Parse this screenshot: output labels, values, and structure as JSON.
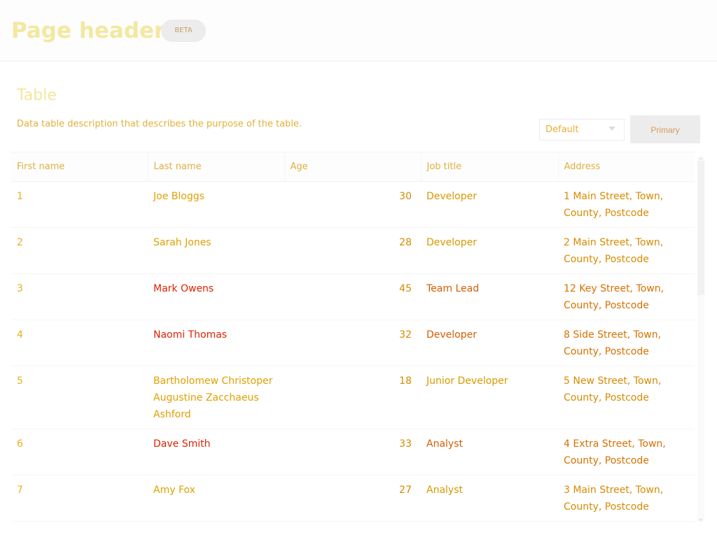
{
  "header": {
    "title": "Page header",
    "badge": "BETA"
  },
  "section": {
    "title": "Table",
    "description": "Data table description that describes the purpose of the table."
  },
  "toolbar": {
    "select_value": "Default",
    "primary_label": "Primary"
  },
  "table": {
    "columns": [
      "First name",
      "Last name",
      "Age",
      "Job title",
      "Address"
    ],
    "rows": [
      {
        "id": "1",
        "name": "Joe Bloggs",
        "age": "30",
        "job": "Developer",
        "address": "1 Main Street, Town, County, Postcode"
      },
      {
        "id": "2",
        "name": "Sarah Jones",
        "age": "28",
        "job": "Developer",
        "address": "2 Main Street, Town, County, Postcode"
      },
      {
        "id": "3",
        "name": "Mark Owens",
        "age": "45",
        "job": "Team Lead",
        "address": "12 Key Street, Town, County, Postcode"
      },
      {
        "id": "4",
        "name": "Naomi Thomas",
        "age": "32",
        "job": "Developer",
        "address": "8 Side Street, Town, County, Postcode"
      },
      {
        "id": "5",
        "name": "Bartholomew Christoper Augustine Zacchaeus Ashford",
        "age": "18",
        "job": "Junior Developer",
        "address": "5 New Street, Town, County, Postcode"
      },
      {
        "id": "6",
        "name": "Dave Smith",
        "age": "33",
        "job": "Analyst",
        "address": "4 Extra Street, Town, County, Postcode"
      },
      {
        "id": "7",
        "name": "Amy Fox",
        "age": "27",
        "job": "Analyst",
        "address": "3 Main Street, Town, County, Postcode"
      }
    ]
  },
  "colors": {
    "title_yellow": "#f3e8a0",
    "text_orange": "#e0a000",
    "text_red": "#e02000",
    "button_bg": "#ececec"
  }
}
